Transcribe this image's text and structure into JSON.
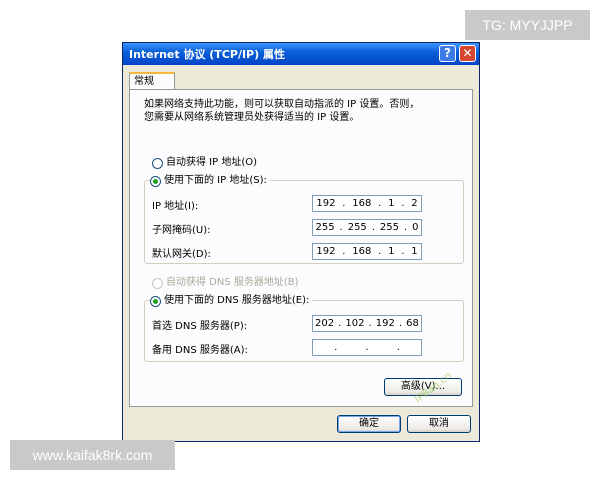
{
  "overlay": {
    "tag": "TG: MYYJJPP",
    "site": "www.kaifak8rk.com"
  },
  "window": {
    "title": "Internet 协议 (TCP/IP) 属性",
    "help_symbol": "?",
    "close_symbol": "✕"
  },
  "tabs": [
    {
      "label": "常规",
      "active": true
    }
  ],
  "description": {
    "line1": "如果网络支持此功能，则可以获取自动指派的 IP 设置。否则，",
    "line2": "您需要从网络系统管理员处获得适当的 IP 设置。"
  },
  "ip_section": {
    "auto_radio": "自动获得 IP 地址(O)",
    "manual_radio": "使用下面的 IP 地址(S):",
    "selected": "manual",
    "fields": [
      {
        "label": "IP 地址(I):",
        "octets": [
          "192",
          "168",
          "1",
          "2"
        ]
      },
      {
        "label": "子网掩码(U):",
        "octets": [
          "255",
          "255",
          "255",
          "0"
        ]
      },
      {
        "label": "默认网关(D):",
        "octets": [
          "192",
          "168",
          "1",
          "1"
        ]
      }
    ]
  },
  "dns_section": {
    "auto_radio": "自动获得 DNS 服务器地址(B)",
    "manual_radio": "使用下面的 DNS 服务器地址(E):",
    "selected": "manual",
    "auto_disabled": true,
    "fields": [
      {
        "label": "首选 DNS 服务器(P):",
        "octets": [
          "202",
          "102",
          "192",
          "68"
        ]
      },
      {
        "label": "备用 DNS 服务器(A):",
        "octets": [
          "",
          "",
          "",
          ""
        ]
      }
    ]
  },
  "buttons": {
    "advanced": "高级(V)...",
    "ok": "确定",
    "cancel": "取消"
  },
  "watermark": "IPBan.cn",
  "colors": {
    "titlebar": "#0a5fd8",
    "dialog_bg": "#ece9d8",
    "radio_dot": "#21a121",
    "close_button": "#d6452e"
  }
}
